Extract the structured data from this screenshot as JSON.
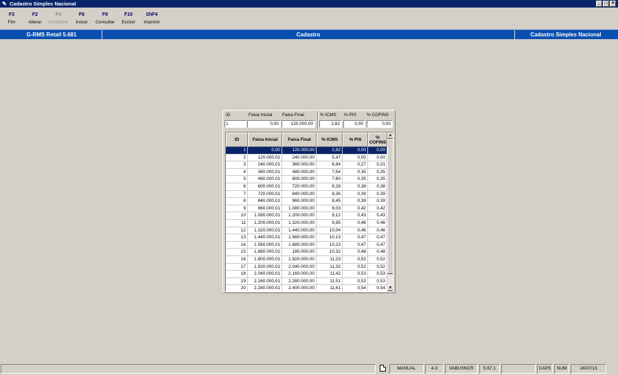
{
  "window": {
    "title": "Cadastro Simples Nacional",
    "controls": [
      "_",
      "□",
      "×"
    ]
  },
  "toolbar": [
    {
      "key": "F3",
      "label": "Fim",
      "enabled": true
    },
    {
      "key": "F2",
      "label": "Alterar",
      "enabled": true
    },
    {
      "key": "F4",
      "label": "Confirmar",
      "enabled": false
    },
    {
      "key": "F6",
      "label": "Incluir",
      "enabled": true
    },
    {
      "key": "F9",
      "label": "Consultar",
      "enabled": true
    },
    {
      "key": "F10",
      "label": "Excluir",
      "enabled": true
    },
    {
      "key": "ShF4",
      "label": "Imprimir",
      "enabled": true
    }
  ],
  "header": {
    "left": "G-RMS Retail 5.681",
    "center": "Cadastro",
    "right": "Cadastro Simples Nacional"
  },
  "form": {
    "id_label": "ID",
    "id_value": "1",
    "faixa_inicial_label": "Faixa Inicial",
    "faixa_inicial_value": "0,00",
    "faixa_final_label": "Faixa Final",
    "faixa_final_value": "120.000,00",
    "icms_label": "% ICMS",
    "icms_value": "2,82",
    "pis_label": "% PIS",
    "pis_value": "0,00",
    "cofins_label": "% COFINS",
    "cofins_value": "0,00"
  },
  "table": {
    "columns": [
      "ID",
      "Faixa Inicial",
      "Faixa Final",
      "% ICMS",
      "% PIS",
      "% COFINS"
    ],
    "selected_index": 0,
    "rows": [
      [
        "1",
        "0,00",
        "120.000,00",
        "2,82",
        "0,00",
        "0,00"
      ],
      [
        "2",
        "120.000,01",
        "240.000,00",
        "5,47",
        "0,00",
        "0,00"
      ],
      [
        "3",
        "240.000,01",
        "360.000,00",
        "6,84",
        "0,27",
        "0,31"
      ],
      [
        "4",
        "360.000,01",
        "480.000,00",
        "7,54",
        "0,35",
        "0,35"
      ],
      [
        "5",
        "480.000,01",
        "600.000,00",
        "7,60",
        "0,35",
        "0,35"
      ],
      [
        "6",
        "600.000,01",
        "720.000,00",
        "8,28",
        "0,38",
        "0,38"
      ],
      [
        "7",
        "720.000,01",
        "840.000,00",
        "8,36",
        "0,39",
        "0,39"
      ],
      [
        "8",
        "840.000,01",
        "960.000,00",
        "8,45",
        "0,39",
        "0,39"
      ],
      [
        "9",
        "960.000,01",
        "1.080.000,00",
        "9,03",
        "0,42",
        "0,42"
      ],
      [
        "10",
        "1.080.000,01",
        "1.200.000,00",
        "9,12",
        "0,43",
        "0,43"
      ],
      [
        "11",
        "1.200.000,01",
        "1.320.000,00",
        "9,95",
        "0,46",
        "0,46"
      ],
      [
        "12",
        "1.320.000,01",
        "1.440.000,00",
        "10,04",
        "0,46",
        "0,46"
      ],
      [
        "13",
        "1.440.000,01",
        "1.560.000,00",
        "10,13",
        "0,47",
        "0,47"
      ],
      [
        "14",
        "1.560.000,01",
        "1.680.000,00",
        "10,23",
        "0,47",
        "0,47"
      ],
      [
        "15",
        "1.680.000,01",
        "180.000,00",
        "10,32",
        "0,48",
        "0,48"
      ],
      [
        "16",
        "1.800.000,01",
        "1.920.000,00",
        "11,23",
        "0,52",
        "0,52"
      ],
      [
        "17",
        "1.920.000,01",
        "2.040.000,00",
        "11,32",
        "0,52",
        "0,52"
      ],
      [
        "18",
        "2.040.000,01",
        "2.160.000,00",
        "11,42",
        "0,53",
        "0,53"
      ],
      [
        "19",
        "2.160.000,01",
        "2.280.000,00",
        "11,51",
        "0,53",
        "0,53"
      ],
      [
        "20",
        "2.280.000,01",
        "2.400.000,00",
        "11,61",
        "0,54",
        "0,54"
      ]
    ]
  },
  "status": {
    "mode": "MANUAL",
    "code": "4-3",
    "user": "VABUSNCR",
    "version": "5.67.1",
    "caps": "CAPS",
    "num": "NUM",
    "date": "24/07/13"
  },
  "icons": {
    "app": "pencil-icon",
    "doc": "document-icon"
  }
}
